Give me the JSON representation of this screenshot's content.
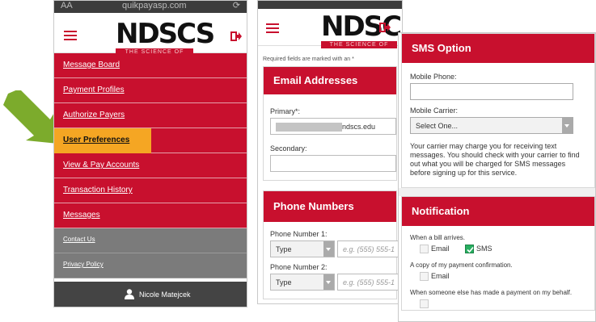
{
  "colors": {
    "brand_red": "#c8102e",
    "highlight": "#f5a623",
    "arrow_green": "#7cab2c",
    "check_green": "#27ae60"
  },
  "phone_menu": {
    "status": {
      "left": "AA",
      "url": "quikpayasp.com"
    },
    "logo": {
      "word": "NDSCS",
      "tagline": "THE SCIENCE OF SUCCESS"
    },
    "items": [
      {
        "label": "Message Board"
      },
      {
        "label": "Payment Profiles"
      },
      {
        "label": "Authorize Payers"
      },
      {
        "label": "User Preferences"
      },
      {
        "label": "View & Pay Accounts"
      },
      {
        "label": "Transaction History"
      },
      {
        "label": "Messages"
      }
    ],
    "secondary_items": [
      {
        "label": "Contact Us"
      },
      {
        "label": "Privacy Policy"
      }
    ],
    "user_name": "Nicole Matejcek",
    "active_index": 3
  },
  "profile_form": {
    "logo": {
      "word": "NDSCS",
      "tagline": "THE SCIENCE OF SUCCESS"
    },
    "required_note": "Required fields are marked with an *",
    "email": {
      "title": "Email Addresses",
      "primary_label": "Primary*:",
      "primary_value": "ndscs.edu",
      "secondary_label": "Secondary:"
    },
    "phone": {
      "title": "Phone Numbers",
      "fields": [
        {
          "label": "Phone Number 1:",
          "type": "Type",
          "placeholder": "e.g. (555) 555-1"
        },
        {
          "label": "Phone Number 2:",
          "type": "Type",
          "placeholder": "e.g. (555) 555-1"
        }
      ]
    }
  },
  "sms_option": {
    "title": "SMS Option",
    "mobile_phone_label": "Mobile Phone:",
    "mobile_carrier_label": "Mobile Carrier:",
    "carrier_select": "Select One...",
    "note": "Your carrier may charge you for receiving text messages. You should check with your carrier to find out what you will be charged for SMS messages before signing up for this service."
  },
  "notification": {
    "title": "Notification",
    "groups": [
      {
        "label": "When a bill arrives.",
        "email_label": "Email",
        "sms_label": "SMS",
        "sms_checked": true
      },
      {
        "label": "A copy of my payment confirmation.",
        "email_label": "Email"
      },
      {
        "label": "When someone else has made a payment on my behalf."
      }
    ]
  }
}
